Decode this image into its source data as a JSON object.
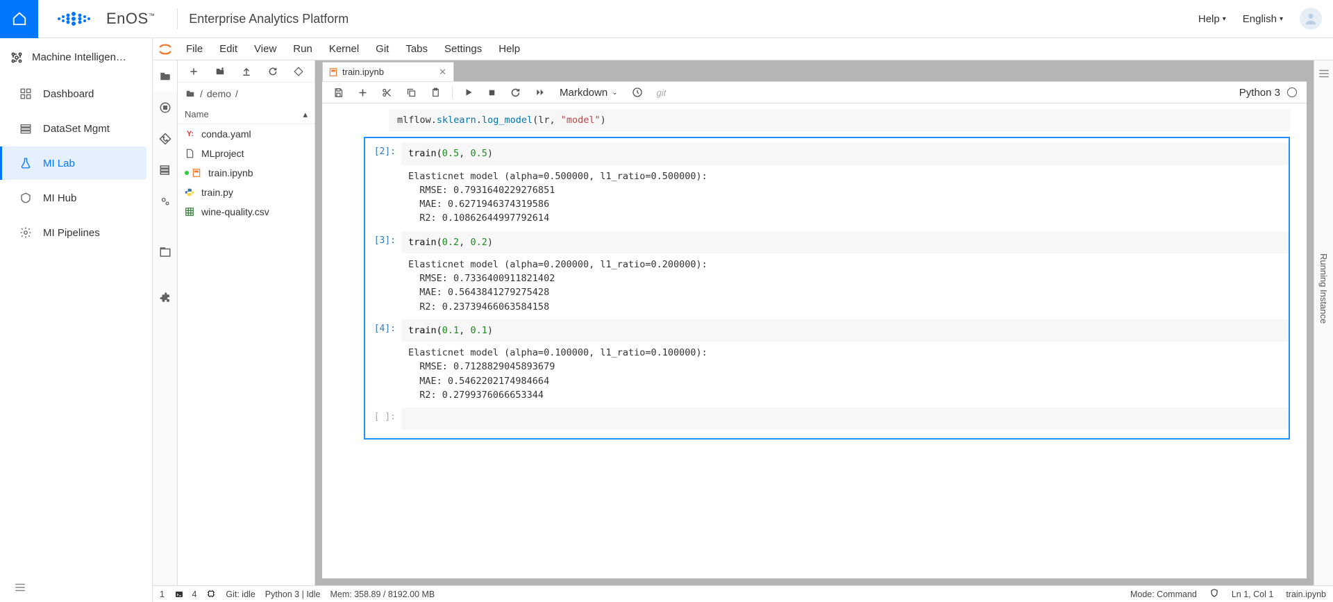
{
  "header": {
    "logo": "EnOS",
    "tm": "™",
    "platform_title": "Enterprise Analytics Platform",
    "help": "Help",
    "language": "English"
  },
  "sidebar": {
    "module_title": "Machine Intelligen…",
    "items": [
      {
        "label": "Dashboard"
      },
      {
        "label": "DataSet Mgmt"
      },
      {
        "label": "MI Lab"
      },
      {
        "label": "MI Hub"
      },
      {
        "label": "MI Pipelines"
      }
    ]
  },
  "lab": {
    "menus": [
      "File",
      "Edit",
      "View",
      "Run",
      "Kernel",
      "Git",
      "Tabs",
      "Settings",
      "Help"
    ],
    "breadcrumb": [
      "/",
      "demo",
      "/"
    ],
    "fb_header_name": "Name",
    "files": [
      {
        "name": "conda.yaml",
        "icon": "yaml"
      },
      {
        "name": "MLproject",
        "icon": "file"
      },
      {
        "name": "train.ipynb",
        "icon": "nb",
        "running": true
      },
      {
        "name": "train.py",
        "icon": "py"
      },
      {
        "name": "wine-quality.csv",
        "icon": "csv"
      }
    ],
    "tab": {
      "label": "train.ipynb"
    },
    "nb_toolbar": {
      "cell_type": "Markdown",
      "git_label": "git"
    },
    "kernel": {
      "name": "Python 3"
    },
    "pre_line": {
      "pre": "mlflow.",
      "attr1": "sklearn",
      "dot1": ".",
      "attr2": "log_model",
      "open": "(lr, ",
      "str": "\"model\"",
      "close": ")"
    },
    "cells": [
      {
        "prompt": "[2]:",
        "code_pre": "train(",
        "arg1": "0.5",
        "sep": ", ",
        "arg2": "0.5",
        "code_post": ")",
        "output": "Elasticnet model (alpha=0.500000, l1_ratio=0.500000):\n  RMSE: 0.7931640229276851\n  MAE: 0.6271946374319586\n  R2: 0.10862644997792614"
      },
      {
        "prompt": "[3]:",
        "code_pre": "train(",
        "arg1": "0.2",
        "sep": ", ",
        "arg2": "0.2",
        "code_post": ")",
        "output": "Elasticnet model (alpha=0.200000, l1_ratio=0.200000):\n  RMSE: 0.7336400911821402\n  MAE: 0.5643841279275428\n  R2: 0.23739466063584158"
      },
      {
        "prompt": "[4]:",
        "code_pre": "train(",
        "arg1": "0.1",
        "sep": ", ",
        "arg2": "0.1",
        "code_post": ")",
        "output": "Elasticnet model (alpha=0.100000, l1_ratio=0.100000):\n  RMSE: 0.7128829045893679\n  MAE: 0.5462202174984664\n  R2: 0.2799376066653344"
      }
    ],
    "empty_prompt": "[ ]:",
    "status": {
      "n1": "1",
      "n2": "4",
      "git": "Git: idle",
      "kernel": "Python 3 | Idle",
      "mem": "Mem: 358.89 / 8192.00 MB",
      "mode": "Mode: Command",
      "ln": "Ln 1, Col 1",
      "file": "train.ipynb"
    }
  },
  "right_panel": "Running Instance"
}
